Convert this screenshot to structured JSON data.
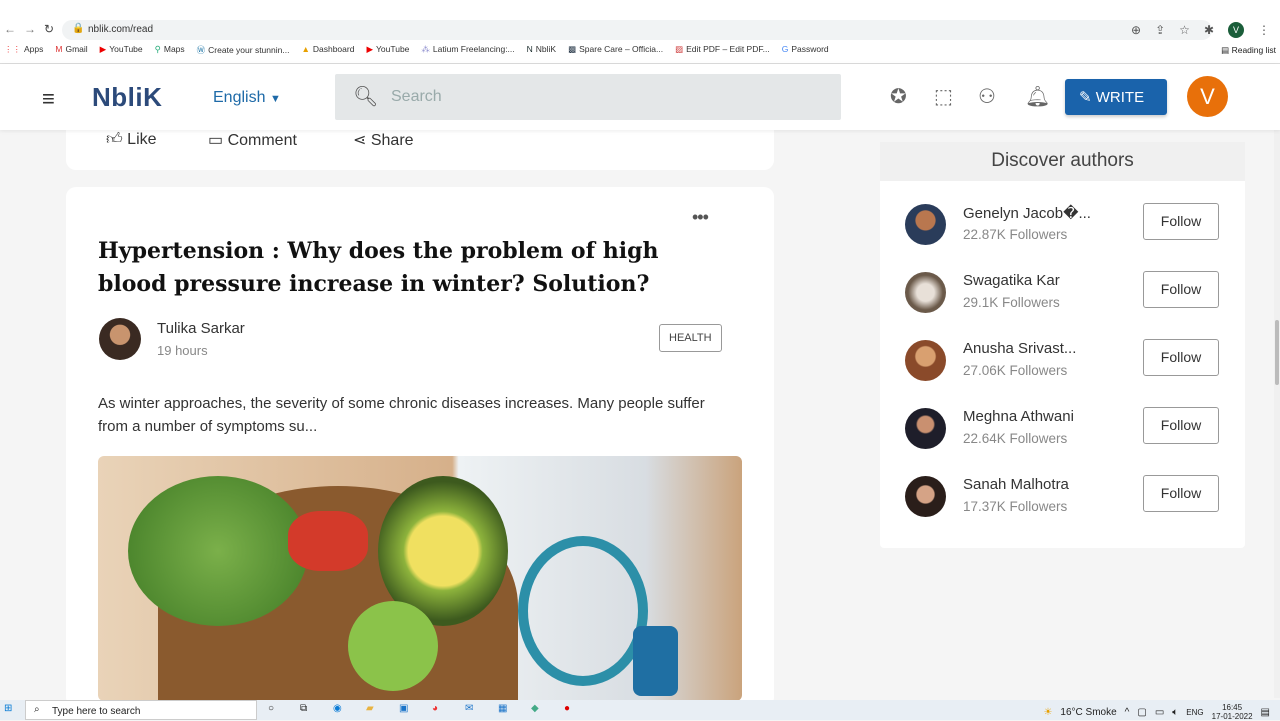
{
  "browser": {
    "url": "nblik.com/read",
    "bookmarks": [
      {
        "icon": "apps-grid-icon",
        "label": "Apps"
      },
      {
        "icon": "gmail-icon",
        "label": "Gmail"
      },
      {
        "icon": "youtube-icon",
        "label": "YouTube"
      },
      {
        "icon": "maps-icon",
        "label": "Maps"
      },
      {
        "icon": "wordpress-icon",
        "label": "Create your stunnin..."
      },
      {
        "icon": "drive-icon",
        "label": "Dashboard"
      },
      {
        "icon": "youtube-icon",
        "label": "YouTube"
      },
      {
        "icon": "latium-icon",
        "label": "Latium Freelancing:..."
      },
      {
        "icon": "nblik-icon",
        "label": "NbliK"
      },
      {
        "icon": "sparecare-icon",
        "label": "Spare Care – Officia..."
      },
      {
        "icon": "pdf-icon",
        "label": "Edit PDF – Edit PDF..."
      },
      {
        "icon": "google-icon",
        "label": "Password"
      }
    ],
    "reading_list": "Reading list",
    "profile_initial": "V"
  },
  "header": {
    "logo": "NbliK",
    "language": "English",
    "search_placeholder": "Search",
    "write_label": "WRITE",
    "avatar_initial": "V"
  },
  "actions": {
    "like": "Like",
    "comment": "Comment",
    "share": "Share"
  },
  "post": {
    "title": "Hypertension : Why does the problem of high blood pressure increase in winter? Solution?",
    "author": "Tulika Sarkar",
    "time": "19 hours",
    "tag": "HEALTH",
    "excerpt": "As winter approaches, the severity of some chronic diseases increases. Many people suffer from a number of symptoms su..."
  },
  "discover": {
    "title": "Discover authors",
    "follow_label": "Follow",
    "authors": [
      {
        "name": "Genelyn Jacob�...",
        "followers": "22.87K Followers"
      },
      {
        "name": "Swagatika Kar",
        "followers": "29.1K Followers"
      },
      {
        "name": "Anusha Srivast...",
        "followers": "27.06K Followers"
      },
      {
        "name": "Meghna Athwani",
        "followers": "22.64K Followers"
      },
      {
        "name": "Sanah Malhotra",
        "followers": "17.37K Followers"
      }
    ]
  },
  "taskbar": {
    "search_placeholder": "Type here to search",
    "weather": "16°C  Smoke",
    "lang": "ENG",
    "time": "16:45",
    "date": "17-01-2022"
  }
}
